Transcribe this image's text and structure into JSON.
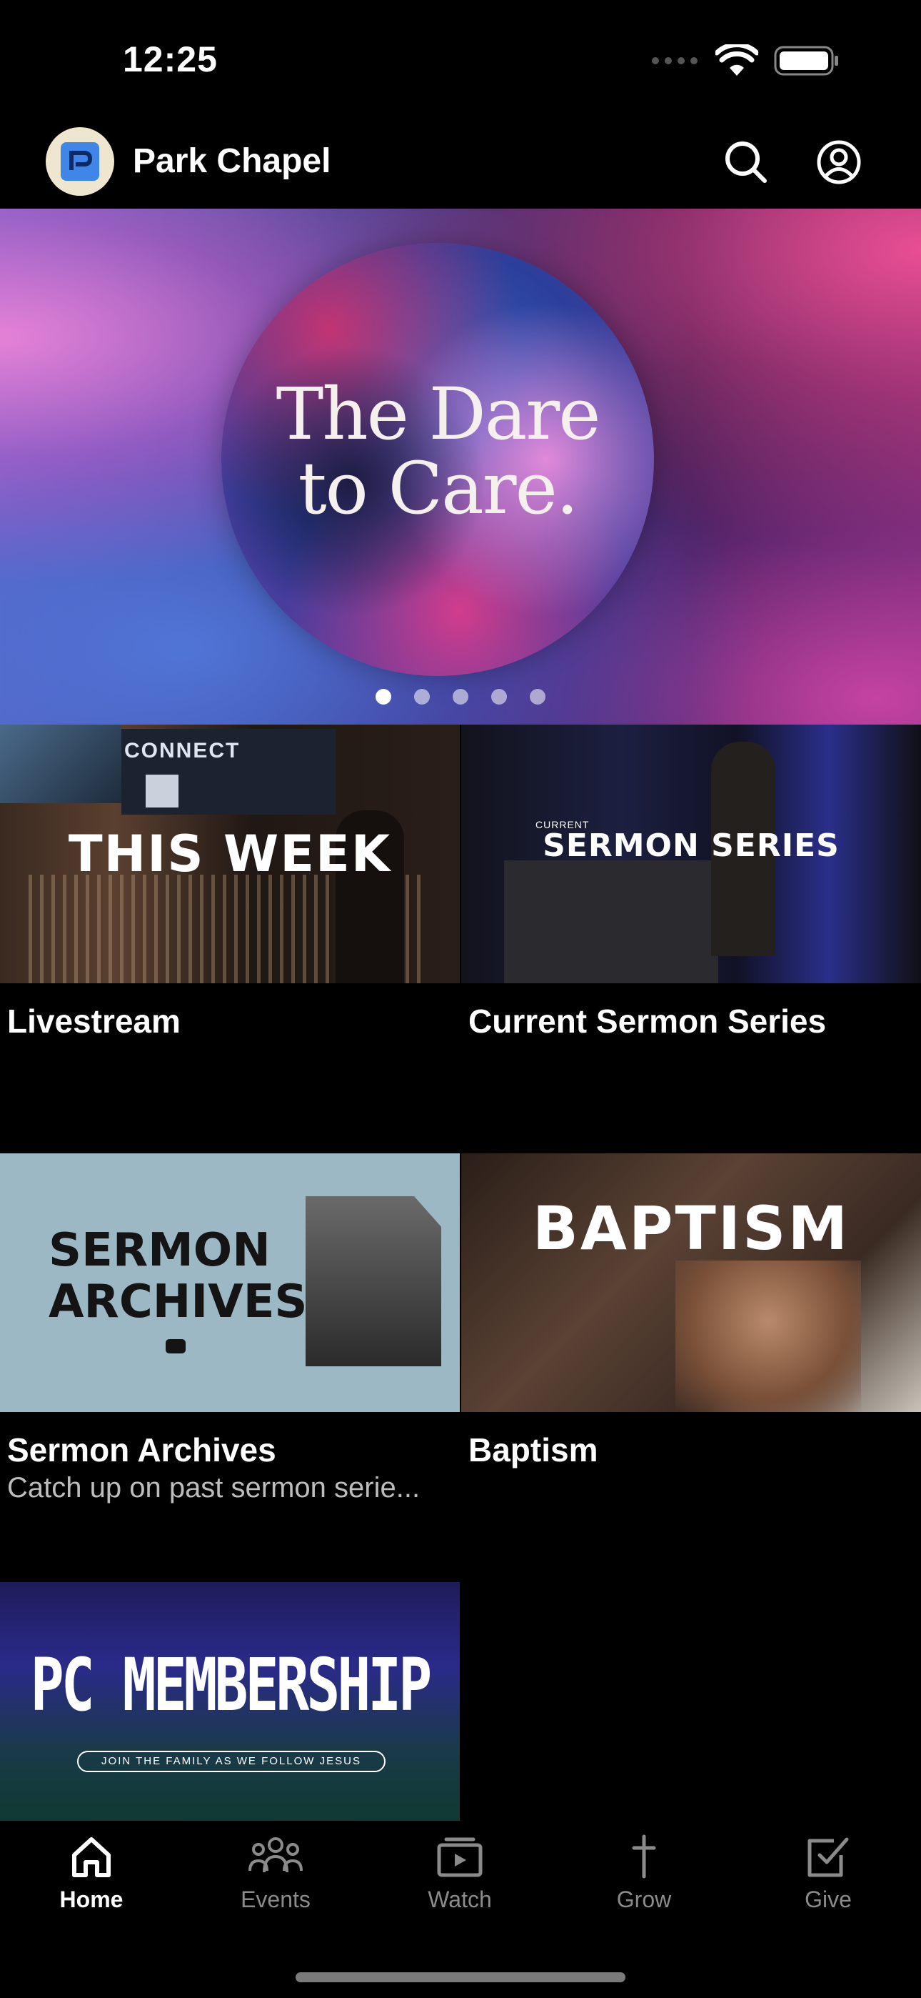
{
  "status_bar": {
    "time": "12:25"
  },
  "header": {
    "title": "Park Chapel"
  },
  "hero": {
    "title_line1": "The Dare",
    "title_line2": "to Care.",
    "slide_count": 5,
    "active_slide": 1
  },
  "cards": [
    {
      "image_text": "THIS WEEK",
      "image_subtext": "CONNECT",
      "title": "Livestream",
      "subtitle": ""
    },
    {
      "image_text": "SERMON SERIES",
      "image_subtext": "CURRENT",
      "title": "Current Sermon Series",
      "subtitle": ""
    },
    {
      "image_text_line1": "SERMON",
      "image_text_line2": "ARCHIVES",
      "title": "Sermon Archives",
      "subtitle": "Catch up on past sermon serie..."
    },
    {
      "image_text": "BAPTISM",
      "title": "Baptism",
      "subtitle": ""
    },
    {
      "image_text": "PC MEMBERSHIP",
      "image_subtext": "JOIN THE FAMILY AS WE FOLLOW JESUS",
      "title": "",
      "subtitle": ""
    }
  ],
  "tabs": [
    {
      "label": "Home",
      "icon": "home-icon",
      "active": true
    },
    {
      "label": "Events",
      "icon": "people-icon",
      "active": false
    },
    {
      "label": "Watch",
      "icon": "tv-icon",
      "active": false
    },
    {
      "label": "Grow",
      "icon": "cross-icon",
      "active": false
    },
    {
      "label": "Give",
      "icon": "checkbox-icon",
      "active": false
    }
  ],
  "colors": {
    "accent": "#3f86e8",
    "inactive_tab": "#8b8b8b",
    "background": "#000000"
  }
}
